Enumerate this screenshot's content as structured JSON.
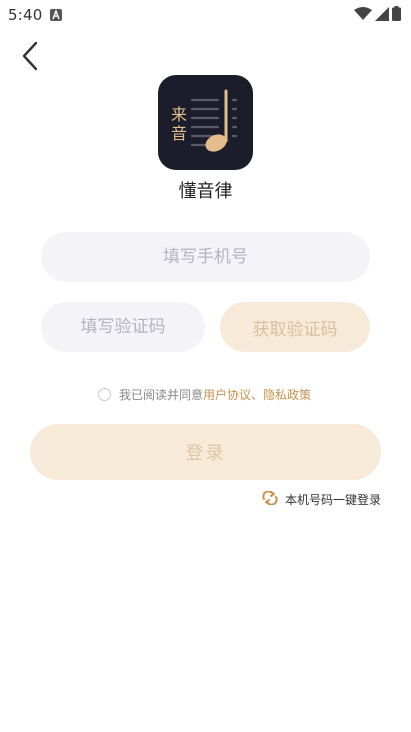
{
  "status_bar": {
    "time": "5:40",
    "icons": [
      "notification-a-icon",
      "wifi-icon",
      "signal-icon",
      "battery-icon"
    ]
  },
  "nav": {
    "back_icon": "chevron-left-icon"
  },
  "app": {
    "logo_text": "来音",
    "name": "懂音律",
    "logo_colors": {
      "bg": "#1c1d2b",
      "accent": "#e3bd8c"
    }
  },
  "form": {
    "phone_placeholder": "填写手机号",
    "code_placeholder": "填写验证码",
    "get_code_label": "获取验证码"
  },
  "agreement": {
    "prefix": "我已阅读并同意",
    "user_agreement": "用户协议",
    "separator": "、",
    "privacy_policy": "隐私政策"
  },
  "login": {
    "label": "登录"
  },
  "one_key_login": {
    "label": "本机号码一键登录",
    "icon": "refresh-icon"
  },
  "colors": {
    "accent": "#c9924d",
    "button_bg": "#f7ead8",
    "button_text": "#dcc6a6",
    "input_bg": "#f4f4f8"
  }
}
